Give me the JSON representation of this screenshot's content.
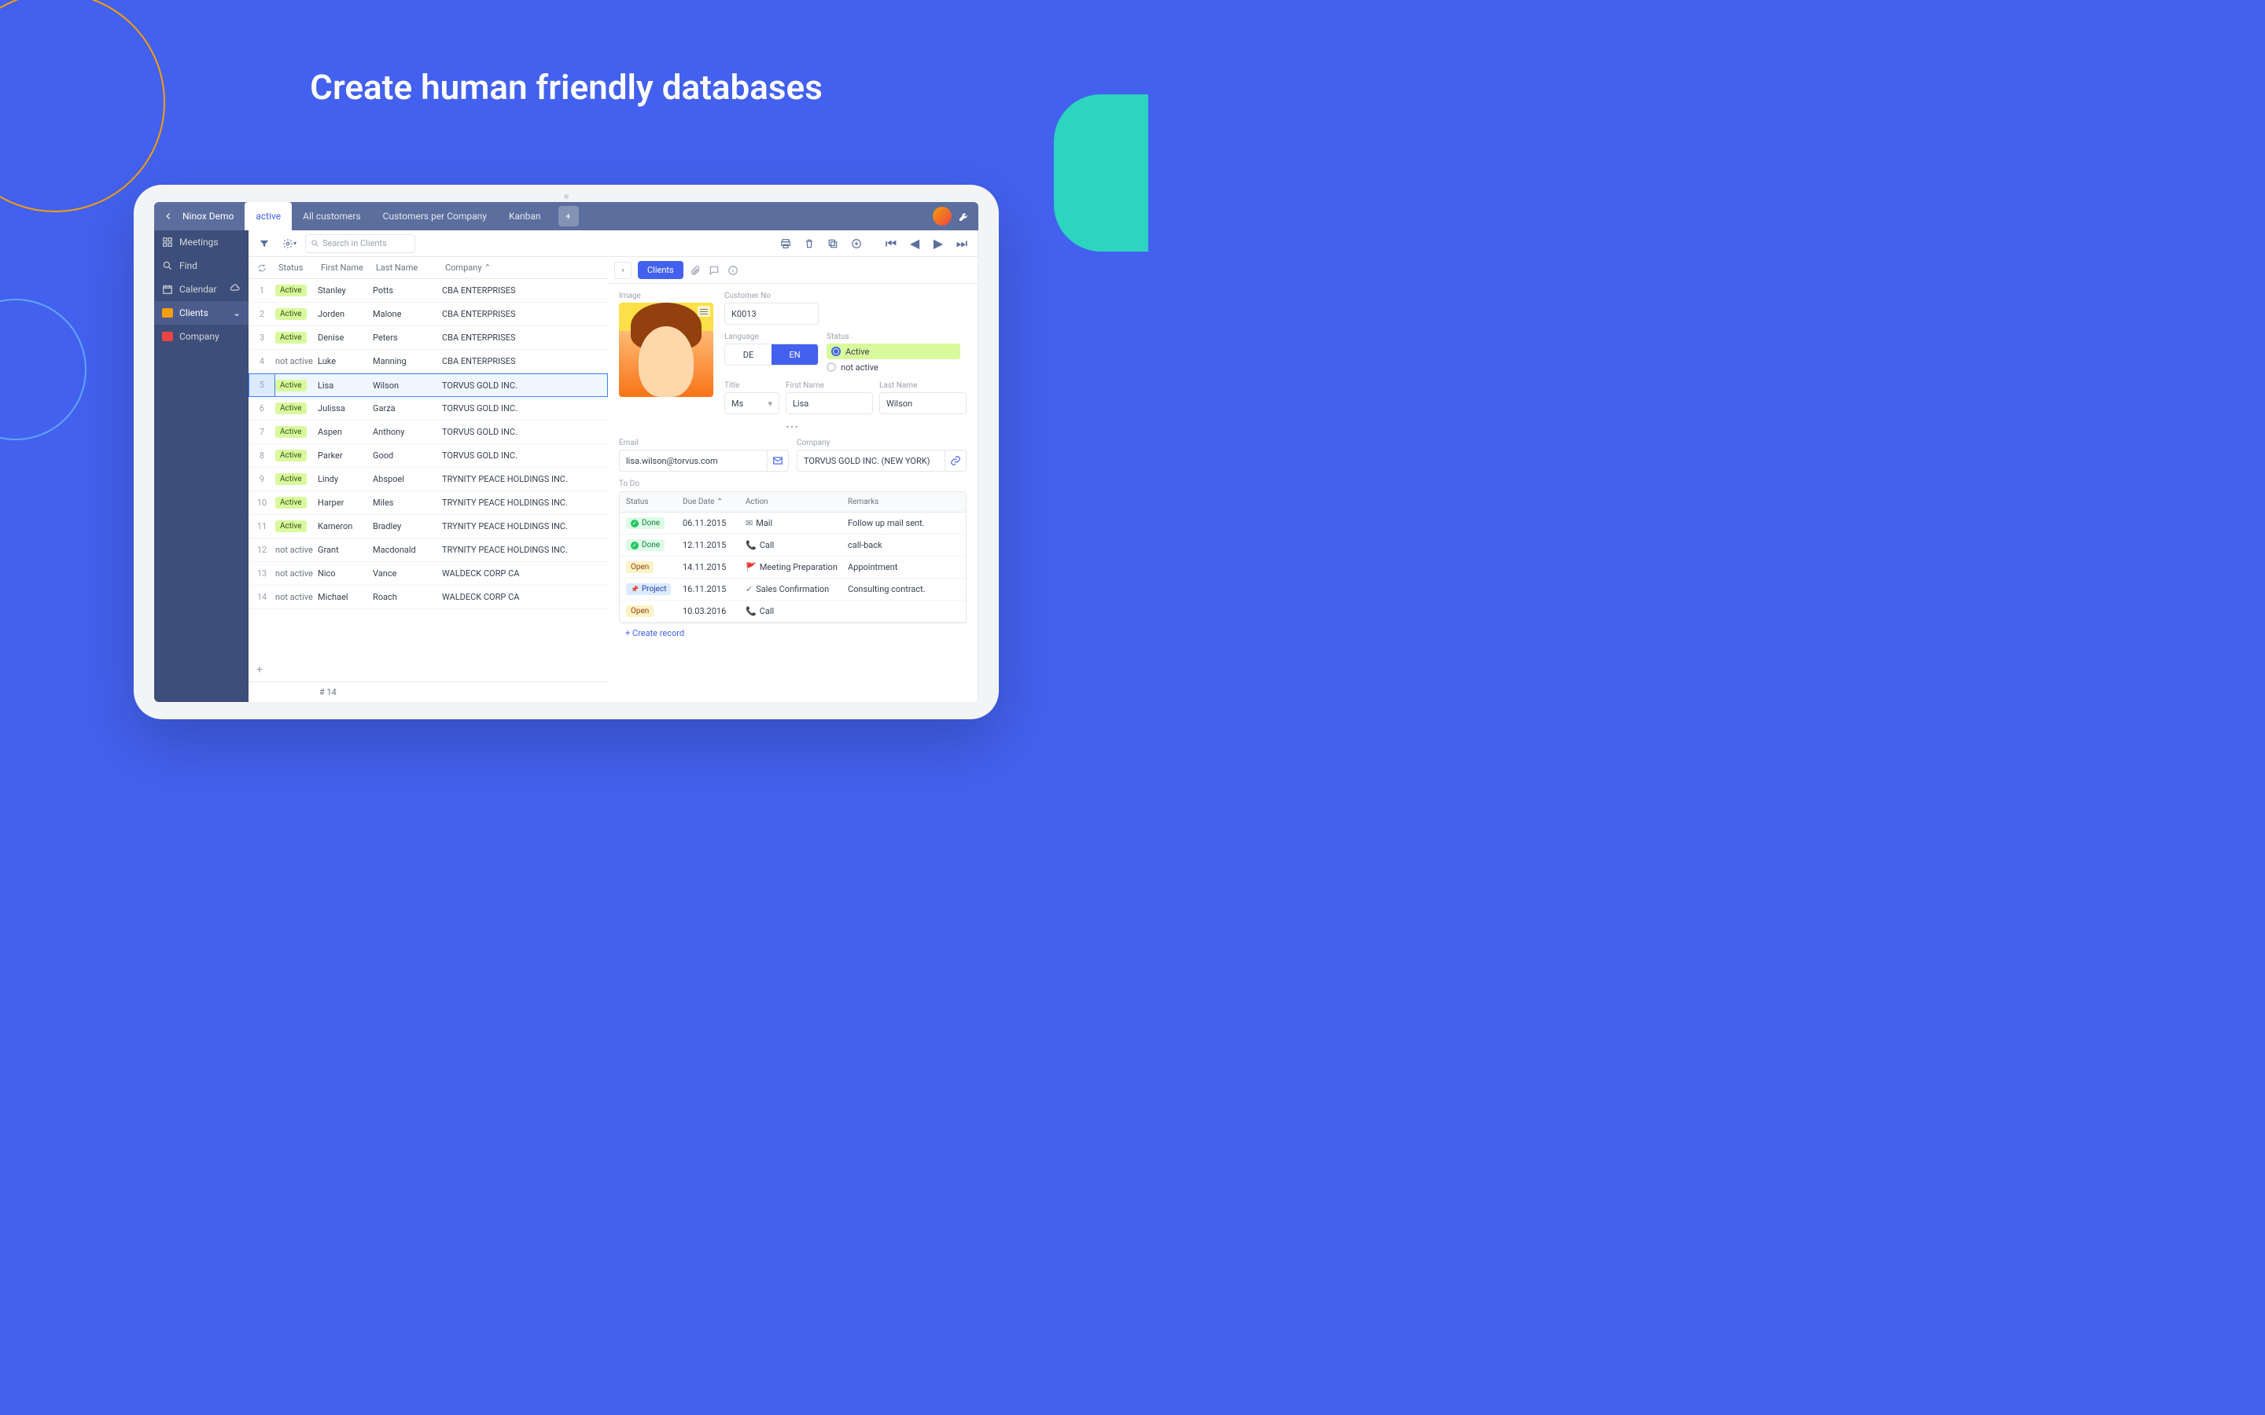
{
  "hero": {
    "title": "Create human friendly databases"
  },
  "app": {
    "db_name": "Ninox Demo",
    "tabs": [
      "active",
      "All customers",
      "Customers per Company",
      "Kanban"
    ],
    "active_tab": "active"
  },
  "sidebar": {
    "items": [
      {
        "label": "Meetings",
        "icon": "grid"
      },
      {
        "label": "Find",
        "icon": "search"
      },
      {
        "label": "Calendar",
        "icon": "calendar",
        "cloud": true
      },
      {
        "label": "Clients",
        "icon": "color-orange",
        "active": true,
        "chevron": true
      },
      {
        "label": "Company",
        "icon": "color-red"
      }
    ]
  },
  "toolbar": {
    "search_placeholder": "Search in Clients"
  },
  "grid": {
    "headers": {
      "status": "Status",
      "first": "First Name",
      "last": "Last Name",
      "company": "Company ⌃"
    },
    "rows": [
      {
        "n": "1",
        "status": "Active",
        "active": true,
        "fn": "Stanley",
        "ln": "Potts",
        "co": "CBA ENTERPRISES"
      },
      {
        "n": "2",
        "status": "Active",
        "active": true,
        "fn": "Jorden",
        "ln": "Malone",
        "co": "CBA ENTERPRISES"
      },
      {
        "n": "3",
        "status": "Active",
        "active": true,
        "fn": "Denise",
        "ln": "Peters",
        "co": "CBA ENTERPRISES"
      },
      {
        "n": "4",
        "status": "not active",
        "active": false,
        "fn": "Luke",
        "ln": "Manning",
        "co": "CBA ENTERPRISES"
      },
      {
        "n": "5",
        "status": "Active",
        "active": true,
        "fn": "Lisa",
        "ln": "Wilson",
        "co": "TORVUS GOLD INC.",
        "selected": true
      },
      {
        "n": "6",
        "status": "Active",
        "active": true,
        "fn": "Julissa",
        "ln": "Garza",
        "co": "TORVUS GOLD INC."
      },
      {
        "n": "7",
        "status": "Active",
        "active": true,
        "fn": "Aspen",
        "ln": "Anthony",
        "co": "TORVUS GOLD INC."
      },
      {
        "n": "8",
        "status": "Active",
        "active": true,
        "fn": "Parker",
        "ln": "Good",
        "co": "TORVUS GOLD INC."
      },
      {
        "n": "9",
        "status": "Active",
        "active": true,
        "fn": "Lindy",
        "ln": "Abspoel",
        "co": "TRYNITY PEACE HOLDINGS INC."
      },
      {
        "n": "10",
        "status": "Active",
        "active": true,
        "fn": "Harper",
        "ln": "Miles",
        "co": "TRYNITY PEACE HOLDINGS INC."
      },
      {
        "n": "11",
        "status": "Active",
        "active": true,
        "fn": "Kameron",
        "ln": "Bradley",
        "co": "TRYNITY PEACE HOLDINGS INC."
      },
      {
        "n": "12",
        "status": "not active",
        "active": false,
        "fn": "Grant",
        "ln": "Macdonald",
        "co": "TRYNITY PEACE HOLDINGS INC."
      },
      {
        "n": "13",
        "status": "not active",
        "active": false,
        "fn": "Nico",
        "ln": "Vance",
        "co": "WALDECK CORP CA"
      },
      {
        "n": "14",
        "status": "not active",
        "active": false,
        "fn": "Michael",
        "ln": "Roach",
        "co": "WALDECK CORP CA"
      }
    ],
    "count": "# 14"
  },
  "detail": {
    "tab": "Clients",
    "labels": {
      "image": "Image",
      "customer_no": "Customer No",
      "language": "Language",
      "status": "Status",
      "title": "Title",
      "first": "First Name",
      "last": "Last Name",
      "email": "Email",
      "company": "Company",
      "todo": "To Do"
    },
    "customer_no": "K0013",
    "lang": {
      "de": "DE",
      "en": "EN",
      "selected": "EN"
    },
    "status": {
      "active": "Active",
      "not_active": "not active",
      "selected": "Active"
    },
    "title": "Ms",
    "first": "Lisa",
    "last": "Wilson",
    "email": "lisa.wilson@torvus.com",
    "company": "TORVUS GOLD INC. (NEW YORK)",
    "collapse_marker": "•••",
    "todo_headers": {
      "status": "Status",
      "date": "Due Date ⌃",
      "action": "Action",
      "remarks": "Remarks"
    },
    "todos": [
      {
        "status": "Done",
        "date": "06.11.2015",
        "icon": "✉",
        "action": "Mail",
        "remarks": "Follow up mail sent."
      },
      {
        "status": "Done",
        "date": "12.11.2015",
        "icon": "📞",
        "action": "Call",
        "remarks": "call-back"
      },
      {
        "status": "Open",
        "date": "14.11.2015",
        "icon": "🚩",
        "action": "Meeting Preparation",
        "remarks": "Appointment"
      },
      {
        "status": "Project",
        "date": "16.11.2015",
        "icon": "✓",
        "action": "Sales Confirmation",
        "remarks": "Consulting contract."
      },
      {
        "status": "Open",
        "date": "10.03.2016",
        "icon": "📞",
        "action": "Call",
        "remarks": ""
      }
    ],
    "create_record": "+  Create record"
  }
}
